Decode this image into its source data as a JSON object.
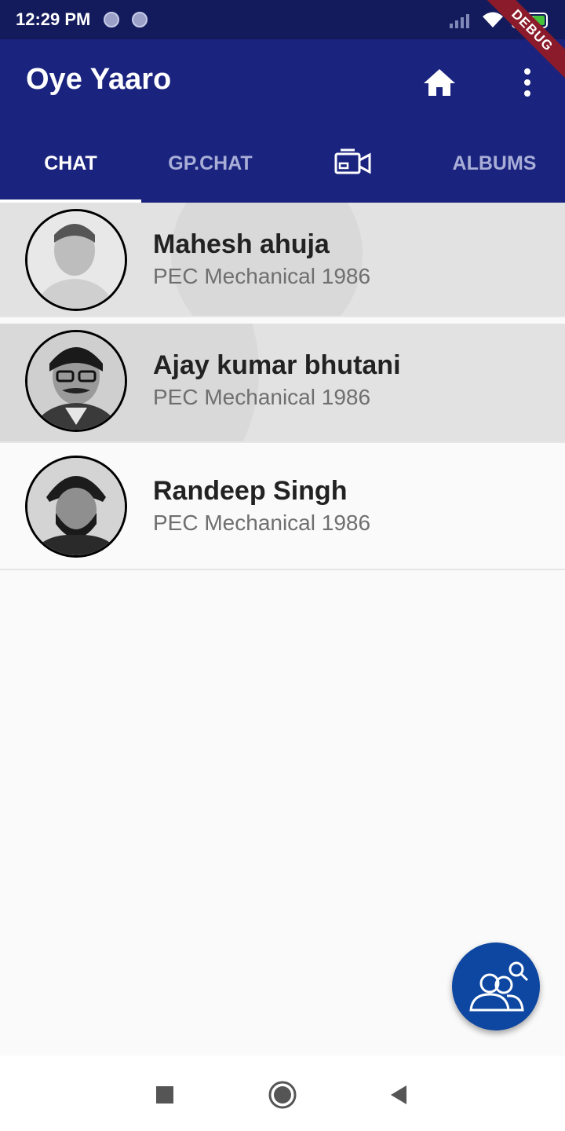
{
  "status_bar": {
    "time": "12:29 PM",
    "battery": "91",
    "icons": [
      "notification-dot-icon",
      "notification-dot-icon",
      "signal-icon",
      "wifi-icon",
      "battery-icon"
    ]
  },
  "debug_banner": "DEBUG",
  "app_bar": {
    "title": "Oye Yaaro",
    "actions": [
      "home-icon",
      "more-vert-icon"
    ]
  },
  "tabs": [
    {
      "label": "CHAT",
      "active": true
    },
    {
      "label": "GP.CHAT",
      "active": false
    },
    {
      "label": "",
      "icon": "video-call-icon",
      "active": false
    },
    {
      "label": "ALBUMS",
      "active": false
    }
  ],
  "contacts": [
    {
      "name": "Mahesh ahuja",
      "subtitle": "PEC Mechanical 1986"
    },
    {
      "name": "Ajay kumar bhutani",
      "subtitle": "PEC Mechanical 1986"
    },
    {
      "name": "Randeep Singh",
      "subtitle": "PEC Mechanical 1986"
    }
  ],
  "fab": {
    "icon": "group-search-icon"
  },
  "colors": {
    "app_bar": "#1a237e",
    "status_bar": "#141b5c",
    "fab": "#0d47a1",
    "tab_inactive": "#a8aed6",
    "battery": "#45c33a",
    "debug_ribbon": "#8b1a2a"
  }
}
